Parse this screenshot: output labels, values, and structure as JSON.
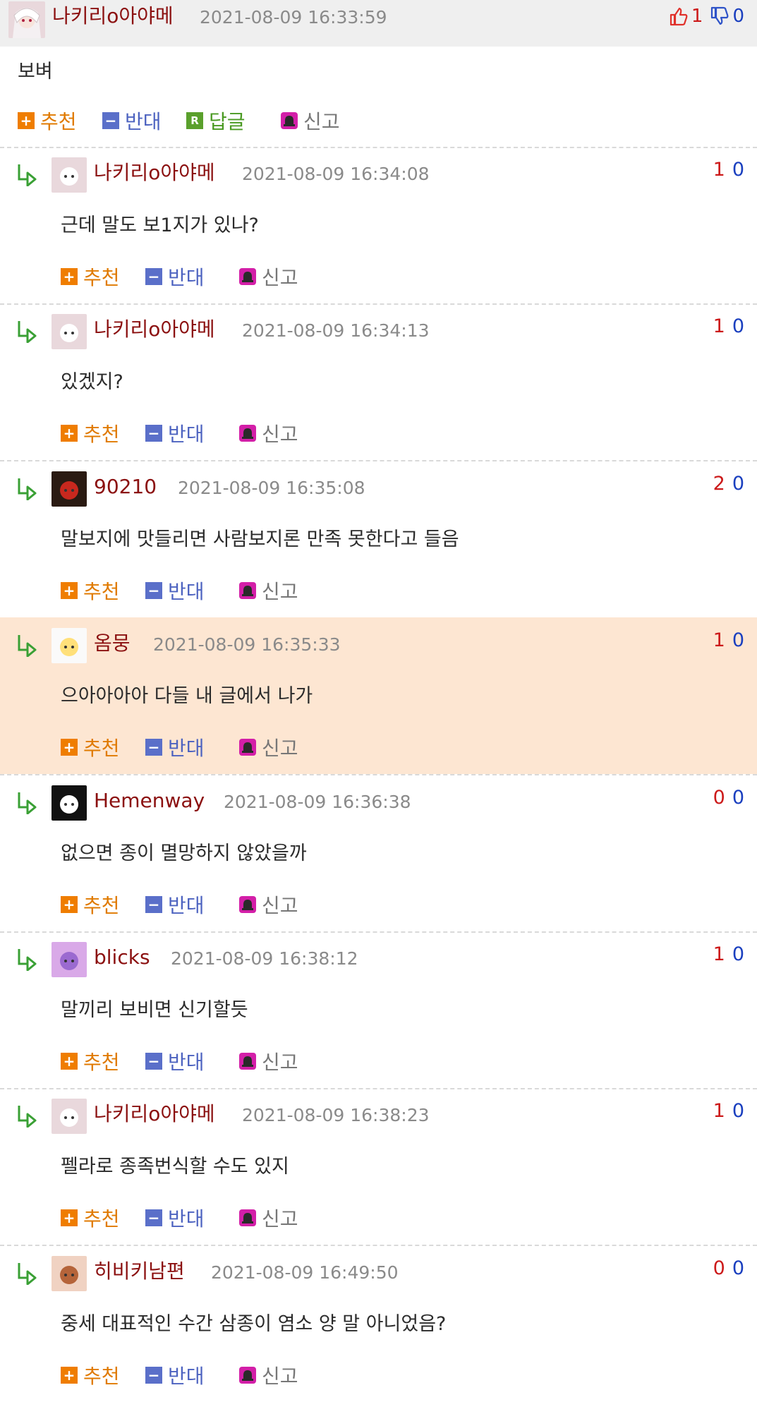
{
  "post": {
    "nickname": "나키리o아야메",
    "datetime": "2021-08-09 16:33:59",
    "likes": "1",
    "dislikes": "0",
    "body": "보벼",
    "actions": {
      "recommend": "추천",
      "oppose": "반대",
      "reply": "답글",
      "report": "신고"
    }
  },
  "icons": {
    "recommend": "plus-icon",
    "oppose": "minus-icon",
    "reply": "r-icon",
    "report": "siren-icon",
    "like": "thumbs-up-icon",
    "dislike": "thumbs-down-icon",
    "reply_marker": "reply-arrow-icon"
  },
  "colors": {
    "nickname": "#8b1010",
    "recommend": "#ef7d00",
    "oppose": "#5a6fc9",
    "report": "#d31fa8",
    "highlight": "#fde6d2"
  },
  "comments": [
    {
      "nickname": "나키리o아야메",
      "datetime": "2021-08-09 16:34:08",
      "up": "1",
      "down": "0",
      "body": "근데 말도 보1지가 있나?",
      "recommend": "추천",
      "oppose": "반대",
      "report": "신고"
    },
    {
      "nickname": "나키리o아야메",
      "datetime": "2021-08-09 16:34:13",
      "up": "1",
      "down": "0",
      "body": "있겠지?",
      "recommend": "추천",
      "oppose": "반대",
      "report": "신고"
    },
    {
      "nickname": "90210",
      "datetime": "2021-08-09 16:35:08",
      "up": "2",
      "down": "0",
      "body": "말보지에 맛들리면 사람보지론 만족 못한다고 들음",
      "recommend": "추천",
      "oppose": "반대",
      "report": "신고"
    },
    {
      "nickname": "옴뭉",
      "datetime": "2021-08-09 16:35:33",
      "up": "1",
      "down": "0",
      "body": "으아아아아 다들 내 글에서 나가",
      "recommend": "추천",
      "oppose": "반대",
      "report": "신고",
      "highlighted": true
    },
    {
      "nickname": "Hemenway",
      "datetime": "2021-08-09 16:36:38",
      "up": "0",
      "down": "0",
      "body": "없으면 종이 멸망하지 않았을까",
      "recommend": "추천",
      "oppose": "반대",
      "report": "신고"
    },
    {
      "nickname": "blicks",
      "datetime": "2021-08-09 16:38:12",
      "up": "1",
      "down": "0",
      "body": "말끼리 보비면 신기할듯",
      "recommend": "추천",
      "oppose": "반대",
      "report": "신고"
    },
    {
      "nickname": "나키리o아야메",
      "datetime": "2021-08-09 16:38:23",
      "up": "1",
      "down": "0",
      "body": "펠라로 종족번식할 수도 있지",
      "recommend": "추천",
      "oppose": "반대",
      "report": "신고"
    },
    {
      "nickname": "히비키남편",
      "datetime": "2021-08-09 16:49:50",
      "up": "0",
      "down": "0",
      "body": "중세 대표적인 수간 삼종이 염소 양 말 아니었음?",
      "recommend": "추천",
      "oppose": "반대",
      "report": "신고"
    }
  ]
}
